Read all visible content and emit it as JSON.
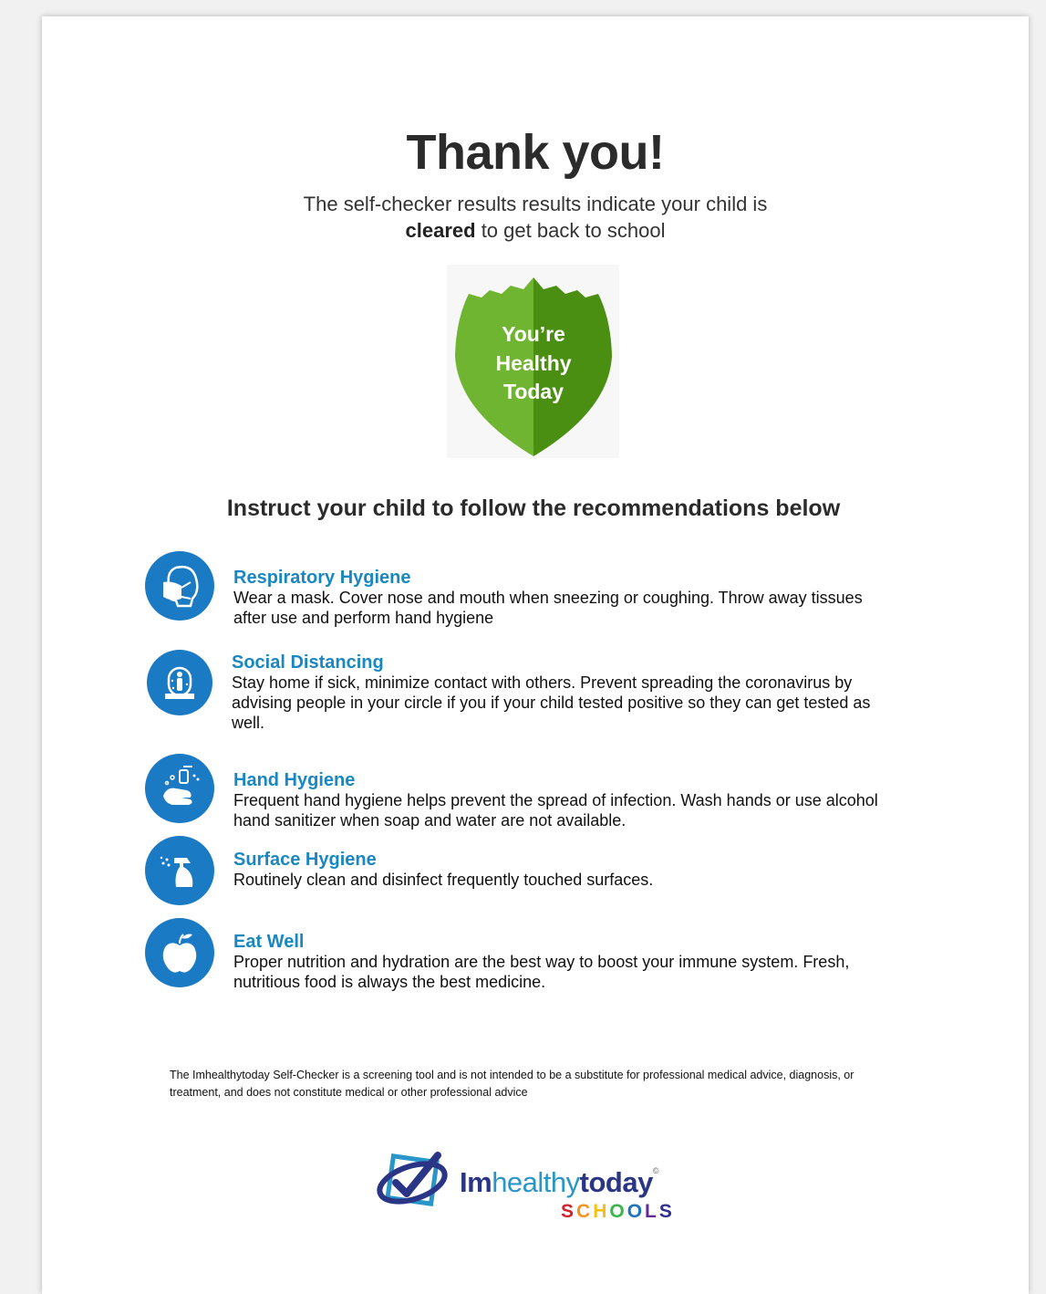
{
  "header": {
    "title": "Thank you!",
    "subtitle_line1": "The self-checker results results indicate your child is",
    "subtitle_bold": "cleared",
    "subtitle_rest": " to get back to school"
  },
  "badge": {
    "line1": "You’re",
    "line2": "Healthy",
    "line3": "Today",
    "colors": {
      "left": "#6fb531",
      "right": "#4a8f12",
      "text": "#ffffff"
    }
  },
  "section_heading": "Instruct your child to follow the recommendations below",
  "recommendations": [
    {
      "icon": "mask-icon",
      "title": "Respiratory Hygiene",
      "body": "Wear a mask. Cover nose and mouth when sneezing or coughing. Throw away tissues after use and perform hand hygiene"
    },
    {
      "icon": "distancing-icon",
      "title": "Social Distancing",
      "body": "Stay home if sick, minimize contact with others. Prevent spreading the coronavirus by advising people in your circle if you if your child  tested positive so they can get tested as well."
    },
    {
      "icon": "hand-wash-icon",
      "title": "Hand Hygiene",
      "body": "Frequent hand hygiene helps prevent the spread of infection. Wash hands or use alcohol hand sanitizer when soap and water are not available."
    },
    {
      "icon": "spray-bottle-icon",
      "title": "Surface Hygiene",
      "body": "Routinely clean and disinfect frequently touched surfaces."
    },
    {
      "icon": "apple-icon",
      "title": "Eat Well",
      "body": "Proper nutrition and hydration are the best way to boost your immune system. Fresh, nutritious food is always the best medicine."
    }
  ],
  "disclaimer": "The Imhealthytoday Self-Checker is a screening tool and is not intended to be a substitute for professional medical advice, diagnosis, or treatment, and does not constitute medical or other professional advice",
  "logo": {
    "word_part1": "Im",
    "word_part2": "healthy",
    "word_part3": "today",
    "copyright": "©",
    "schools_letters": [
      "S",
      "C",
      "H",
      "O",
      "O",
      "L",
      "S"
    ],
    "schools_colors": [
      "#d2232a",
      "#f7941d",
      "#f2c20f",
      "#39b54a",
      "#1c75bc",
      "#662d91",
      "#2e3192"
    ]
  },
  "colors": {
    "accent_blue": "#1a7bc4",
    "title_blue": "#1887c2"
  }
}
